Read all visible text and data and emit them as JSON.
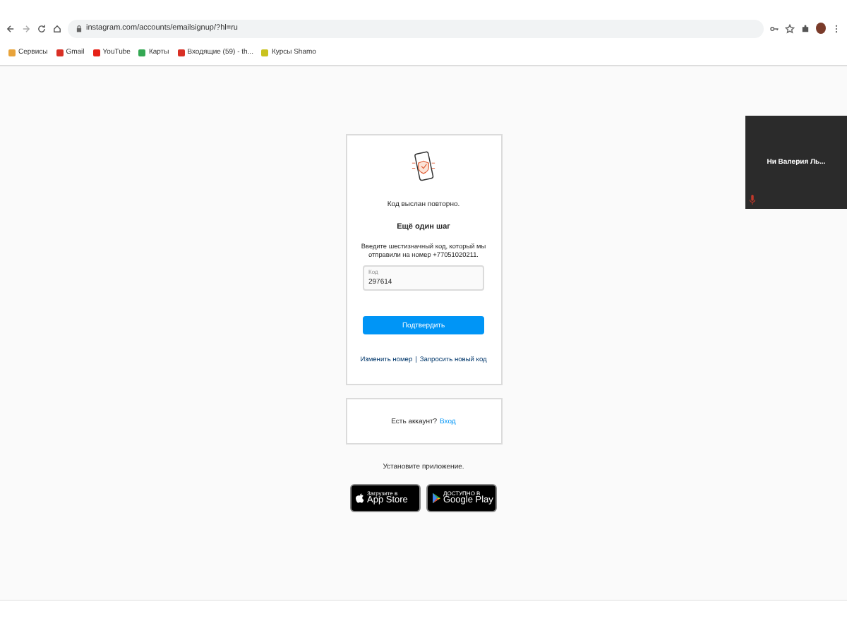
{
  "browser": {
    "url": "instagram.com/accounts/emailsignup/?hl=ru",
    "bookmarks": [
      {
        "label": "Сервисы",
        "color": "#e8a33a"
      },
      {
        "label": "Gmail",
        "color": "#d93025"
      },
      {
        "label": "YouTube",
        "color": "#e62117"
      },
      {
        "label": "Карты",
        "color": "#34a853"
      },
      {
        "label": "Входящие (59) - th...",
        "color": "#d93025"
      },
      {
        "label": "Курсы Shamo",
        "color": "#c9c21e"
      }
    ]
  },
  "card": {
    "notice": "Код выслан повторно.",
    "heading": "Ещё один шаг",
    "instructions": "Введите шестизначный код, который мы отправили на номер +77051020211.",
    "code_field": {
      "label": "Код",
      "value": "297614"
    },
    "confirm_button": "Подтвердить",
    "change_number": "Изменить номер",
    "separator": "|",
    "request_code": "Запросить новый код"
  },
  "login_card": {
    "text": "Есть аккаунт?",
    "link": "Вход"
  },
  "install": {
    "text": "Установите приложение.",
    "app_store": {
      "small": "Загрузите в",
      "big": "App Store"
    },
    "google_play": {
      "small": "ДОСТУПНО В",
      "big": "Google Play"
    }
  },
  "video_tile": {
    "name": "Ни Валерия Ль..."
  }
}
